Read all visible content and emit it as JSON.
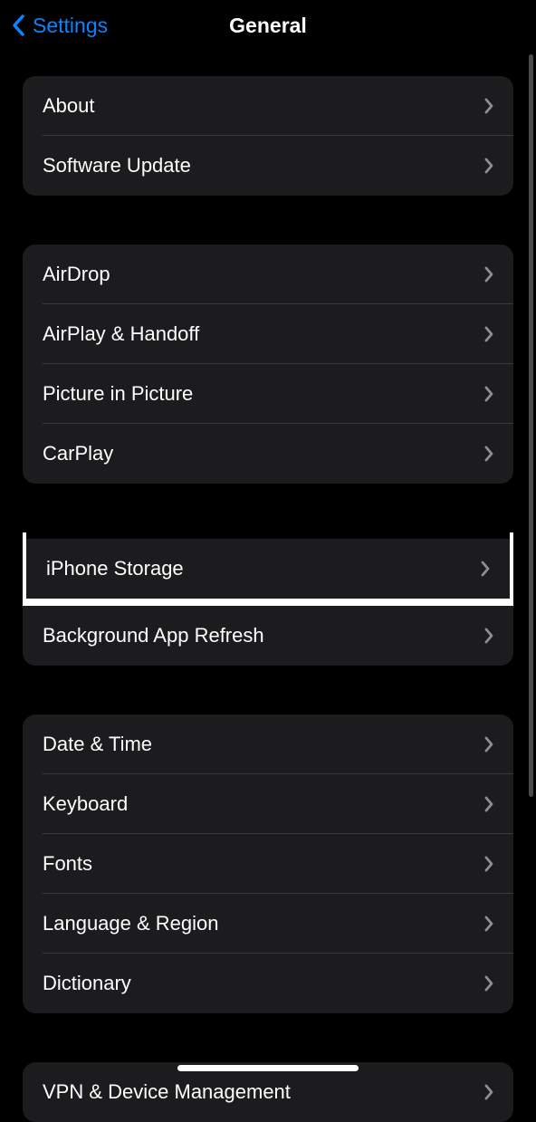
{
  "nav": {
    "back_label": "Settings",
    "title": "General"
  },
  "groups": [
    {
      "items": [
        {
          "key": "about",
          "label": "About"
        },
        {
          "key": "software-update",
          "label": "Software Update"
        }
      ]
    },
    {
      "items": [
        {
          "key": "airdrop",
          "label": "AirDrop"
        },
        {
          "key": "airplay-handoff",
          "label": "AirPlay & Handoff"
        },
        {
          "key": "picture-in-picture",
          "label": "Picture in Picture"
        },
        {
          "key": "carplay",
          "label": "CarPlay"
        }
      ]
    },
    {
      "items": [
        {
          "key": "iphone-storage",
          "label": "iPhone Storage",
          "highlighted": true
        },
        {
          "key": "background-app-refresh",
          "label": "Background App Refresh"
        }
      ]
    },
    {
      "items": [
        {
          "key": "date-time",
          "label": "Date & Time"
        },
        {
          "key": "keyboard",
          "label": "Keyboard"
        },
        {
          "key": "fonts",
          "label": "Fonts"
        },
        {
          "key": "language-region",
          "label": "Language & Region"
        },
        {
          "key": "dictionary",
          "label": "Dictionary"
        }
      ]
    },
    {
      "items": [
        {
          "key": "vpn-device-management",
          "label": "VPN & Device Management"
        }
      ]
    }
  ]
}
